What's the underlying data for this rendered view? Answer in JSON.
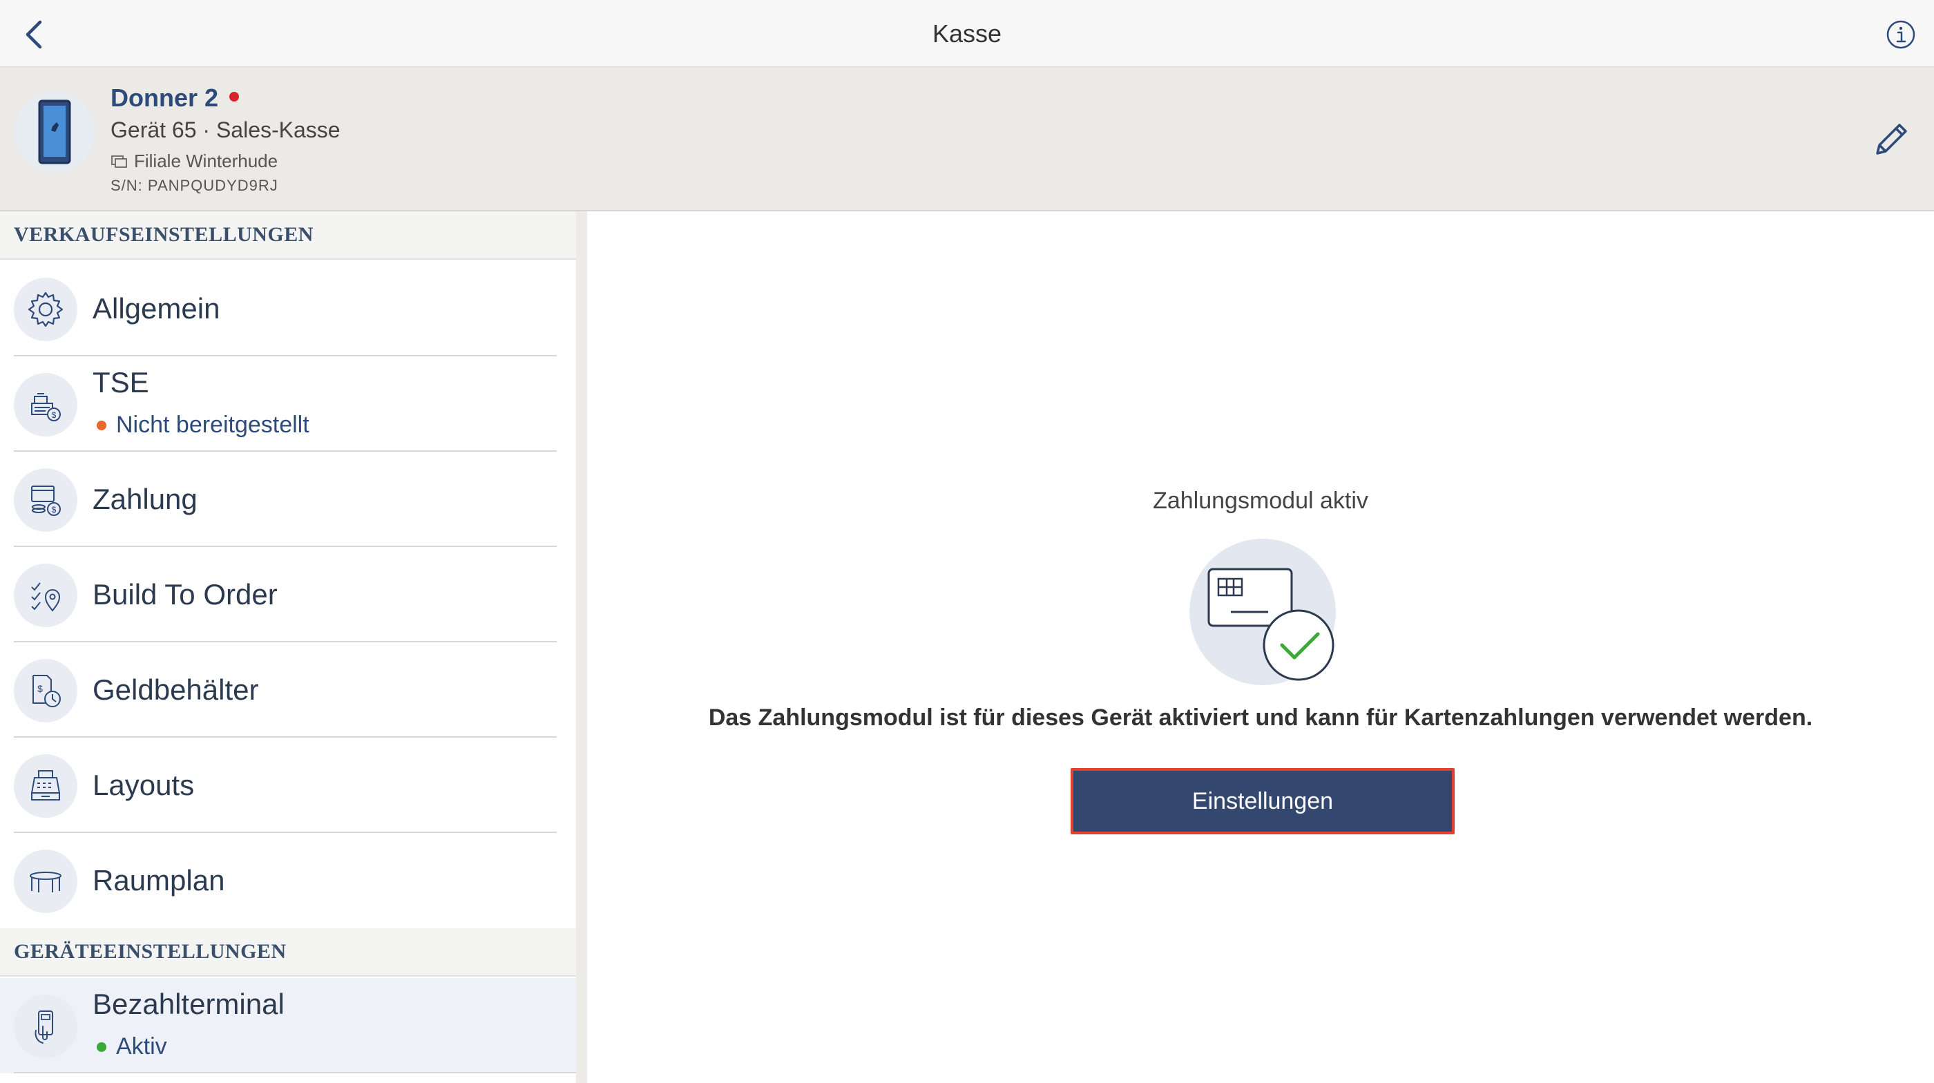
{
  "topbar": {
    "title": "Kasse",
    "back_icon": "chevron-left-icon",
    "info_icon": "info-icon"
  },
  "device": {
    "name": "Donner 2",
    "status_color": "#d8232a",
    "subtitle": "Gerät 65 · Sales-Kasse",
    "branch": "Filiale Winterhude",
    "serial": "S/N: PANPQUDYD9RJ",
    "icon": "tablet-device-icon",
    "edit_icon": "pencil-icon"
  },
  "sidebar": {
    "section_sales": "VERKAUFSEINSTELLUNGEN",
    "section_device": "GERÄTEEINSTELLUNGEN",
    "items": [
      {
        "label": "Allgemein",
        "icon": "gear-icon"
      },
      {
        "label": "TSE",
        "icon": "tse-register-icon",
        "status": "Nicht bereitgestellt",
        "status_color": "#e8672a"
      },
      {
        "label": "Zahlung",
        "icon": "payment-icon"
      },
      {
        "label": "Build To Order",
        "icon": "checklist-location-icon"
      },
      {
        "label": "Geldbehälter",
        "icon": "cash-drawer-clock-icon"
      },
      {
        "label": "Layouts",
        "icon": "register-layout-icon"
      },
      {
        "label": "Raumplan",
        "icon": "table-icon"
      }
    ],
    "device_items": [
      {
        "label": "Bezahlterminal",
        "icon": "card-terminal-icon",
        "status": "Aktiv",
        "status_color": "#3aa935",
        "selected": true
      }
    ]
  },
  "main": {
    "module_title": "Zahlungsmodul aktiv",
    "illustration_icon": "card-check-icon",
    "description": "Das Zahlungsmodul ist für dieses Gerät aktiviert und kann für Kartenzahlungen verwendet werden.",
    "button_label": "Einstellungen",
    "button_color": "#34476f",
    "button_highlight": "#e0412f"
  }
}
